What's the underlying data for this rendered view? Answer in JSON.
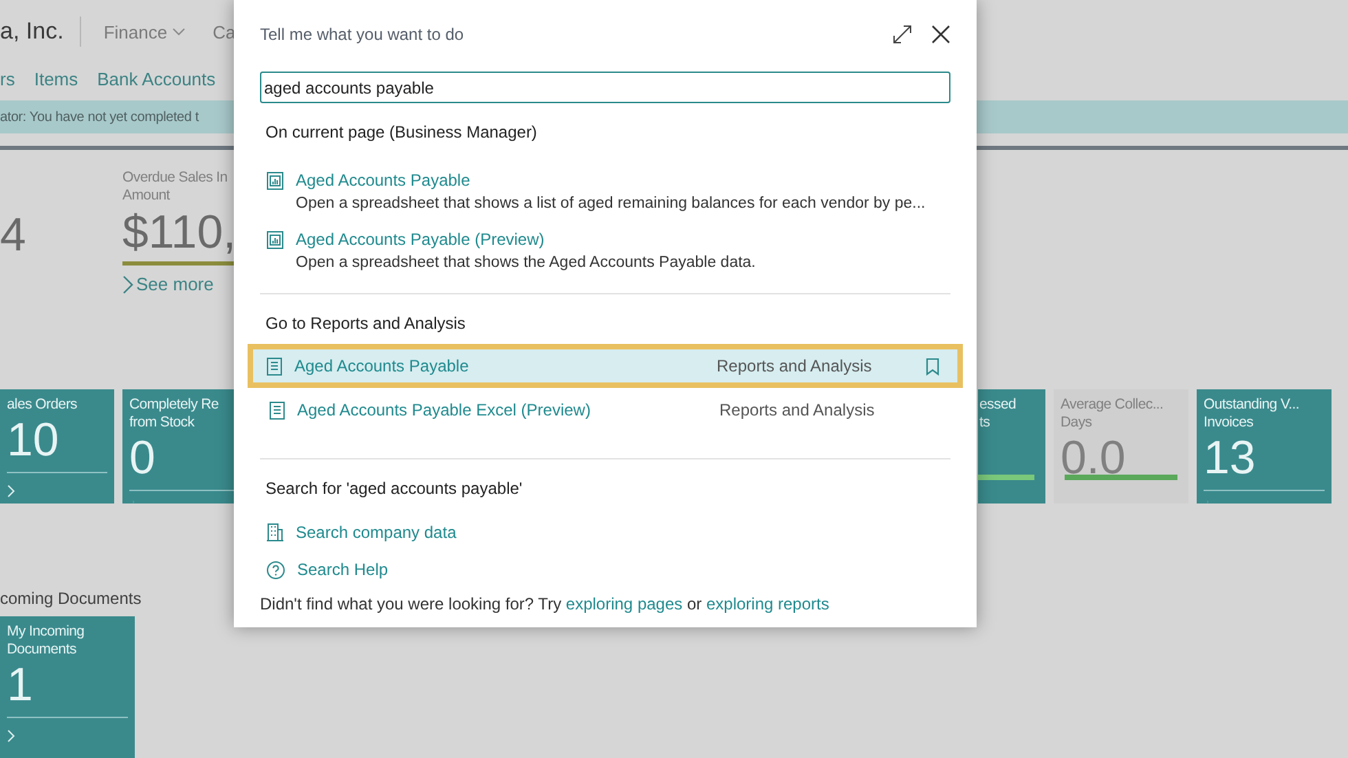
{
  "header": {
    "company": "a, Inc.",
    "menus": [
      {
        "label": "Finance",
        "dropdown": true
      },
      {
        "label": "Ca",
        "dropdown": false
      }
    ]
  },
  "nav": [
    "rs",
    "Items",
    "Bank Accounts"
  ],
  "banner": "ator: You have not yet completed t",
  "kpi_left": {
    "value": "4"
  },
  "kpi": {
    "label": [
      "Overdue Sales In",
      "Amount"
    ],
    "value": "$110,",
    "link": "See more"
  },
  "tiles": [
    {
      "title": [
        "ales Orders"
      ],
      "value": "10",
      "kind": "teal",
      "bar": false
    },
    {
      "title": [
        "Completely Re",
        "from Stock"
      ],
      "value": "0",
      "kind": "teal",
      "bar": false
    },
    {
      "title": [
        "essed",
        "ts"
      ],
      "kind": "teal",
      "bar": true
    },
    {
      "title": [
        "Average Collec...",
        "Days"
      ],
      "value": "0.0",
      "kind": "grey",
      "bar": true
    },
    {
      "title": [
        "Outstanding V...",
        "Invoices"
      ],
      "value": "13",
      "kind": "teal",
      "bar": false
    }
  ],
  "incoming": {
    "heading": "coming Documents",
    "tiles": [
      {
        "title": [
          "My Incoming",
          "Documents"
        ],
        "value": "1",
        "kind": "teal",
        "bar": false
      }
    ]
  },
  "dialog": {
    "title": "Tell me what you want to do",
    "search": {
      "value": "aged accounts payable"
    },
    "sections": [
      {
        "heading": "On current page (Business Manager)",
        "items": [
          {
            "kind": "page",
            "title": "Aged Accounts Payable",
            "description": "Open a spreadsheet that shows a list of aged remaining balances for each vendor by pe..."
          },
          {
            "kind": "page",
            "title": "Aged Accounts Payable (Preview)",
            "description": "Open a spreadsheet that shows the Aged Accounts Payable data."
          }
        ]
      },
      {
        "heading": "Go to Reports and Analysis",
        "items": [
          {
            "kind": "report",
            "title": "Aged Accounts Payable",
            "category": "Reports and Analysis",
            "selected": true
          },
          {
            "kind": "report",
            "title": "Aged Accounts Payable Excel (Preview)",
            "category": "Reports and Analysis",
            "selected": false
          }
        ]
      },
      {
        "heading": "Search for 'aged accounts payable'",
        "items": [
          {
            "kind": "company",
            "title": "Search company data"
          },
          {
            "kind": "help",
            "title": "Search Help"
          }
        ]
      }
    ],
    "footer": {
      "text": "Didn't find what you were looking for? Try",
      "link1": "exploring pages",
      "between": "or",
      "link2": "exploring reports"
    }
  }
}
